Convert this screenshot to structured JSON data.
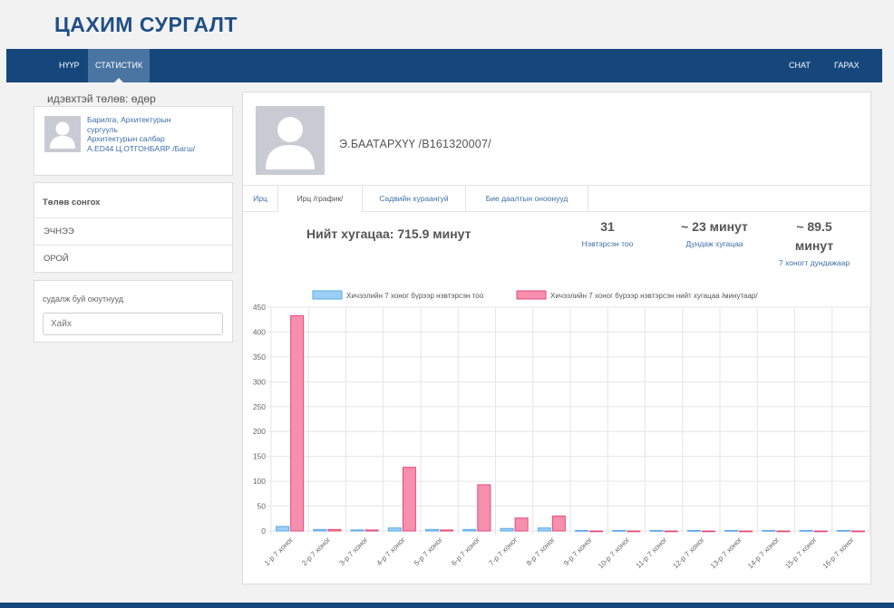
{
  "brand": "ЦАХИМ СУРГАЛТ",
  "nav": {
    "home": "НҮҮР",
    "stats": "СТАТИСТИК",
    "chat": "CHAT",
    "logout": "ГАРАХ"
  },
  "sidebar": {
    "active_term": "идэвхтэй төлөв: өдөр",
    "profile": {
      "line1": "Барилга, Архитектурын",
      "line2": "сургууль",
      "line3": "Архитектурын салбар",
      "line4": "A.ED44 Ц.ОТГОНБАЯР /Багш/"
    },
    "term_menu": {
      "title": "Төлөв сонгох",
      "items": [
        "ЭЧНЭЭ",
        "ОРОЙ"
      ]
    },
    "search": {
      "label": "судалж буй оюутнууд",
      "placeholder": "Хайх"
    }
  },
  "student": {
    "name": "Э.БААТАРХҮҮ /B161320007/"
  },
  "tabs": [
    "Ирц",
    "Ирц /график/",
    "Садвийн хураангуй",
    "Бие даалтын оноонууд"
  ],
  "summary": {
    "total_time": "Нийт хугацаа: 715.9 минут",
    "logins": {
      "value": "31",
      "label": "Нэвтэрсэн тоо"
    },
    "avg": {
      "value": "~ 23 минут",
      "label": "Дундаж хугацаа"
    },
    "weekly": {
      "value_line1": "~ 89.5",
      "value_line2": "минут",
      "label": "7 хоногт дундажаар"
    }
  },
  "colors": {
    "primary_nav": "#15477c",
    "nav_active": "#4a74a2",
    "link": "#3c6fa8",
    "series_logins_fill": "#9ccff5",
    "series_logins_stroke": "#5aa8e6",
    "series_time_fill": "#f78fae",
    "series_time_stroke": "#e24b78"
  },
  "chart_data": {
    "type": "bar",
    "categories": [
      "1-р 7 хоног",
      "2-р 7 хоног",
      "3-р 7 хоног",
      "4-р 7 хоног",
      "5-р 7 хоног",
      "6-р 7 хоног",
      "7-р 7 хоног",
      "8-р 7 хоног",
      "9-р 7 хоног",
      "10-р 7 хоног",
      "11-р 7 хоног",
      "12-р 7 хоног",
      "13-р 7 хоног",
      "14-р 7 хоног",
      "15-р 7 хоног",
      "16-р 7 хоног"
    ],
    "series": [
      {
        "name": "Хичээлийн 7 хоног бүрээр нэвтэрсэн тоо",
        "values": [
          9,
          3,
          2,
          6,
          3,
          3,
          5,
          6,
          1,
          1,
          1,
          1,
          1,
          1,
          1,
          1
        ]
      },
      {
        "name": "Хичээлийн 7 хоног бүрээр нэвтэрсэн нийт хугацаа /минутаар/",
        "values": [
          433,
          3,
          2,
          128,
          2,
          93,
          26,
          30,
          0,
          0,
          0,
          0,
          0,
          0,
          0,
          0
        ]
      }
    ],
    "ylim": [
      0,
      450
    ],
    "yticks": [
      0,
      50,
      100,
      150,
      200,
      250,
      300,
      350,
      400,
      450
    ],
    "grid": true,
    "legend": "top"
  }
}
